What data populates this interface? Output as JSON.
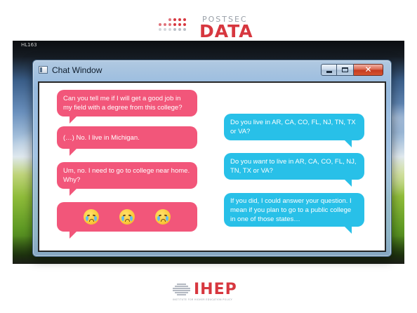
{
  "top_logo": {
    "small": "POSTSEC",
    "big": "DATA"
  },
  "desktop": {
    "label": "HL163"
  },
  "window": {
    "title": "Chat Window",
    "buttons": {
      "minimize": "",
      "maximize": "",
      "close": "✕"
    }
  },
  "messages_left": [
    {
      "text": "Can you tell me if I will get a good job in my field with a degree from this college?"
    },
    {
      "text": "(…) No. I live in Michigan."
    },
    {
      "text": "Um, no. I need to go to college near home. Why?"
    },
    {
      "emoji": [
        "crying-face",
        "crying-face",
        "crying-face"
      ]
    }
  ],
  "messages_right": [
    {
      "text": "Do you live in AR, CA, CO, FL, NJ, TN, TX or VA?"
    },
    {
      "text_before": "Do you ",
      "text_emph": "want",
      "text_after": " to live in AR, CA, CO, FL, NJ, TN, TX or VA?"
    },
    {
      "text": "If you did, I could answer your question. I mean if you plan to go to a public college in one of those states…"
    }
  ],
  "bottom_logo": {
    "name": "IHEP",
    "tagline": "INSTITUTE FOR HIGHER EDUCATION POLICY"
  },
  "colors": {
    "pink": "#f2567a",
    "cyan": "#28c0e8",
    "brand_red": "#d7373f"
  }
}
